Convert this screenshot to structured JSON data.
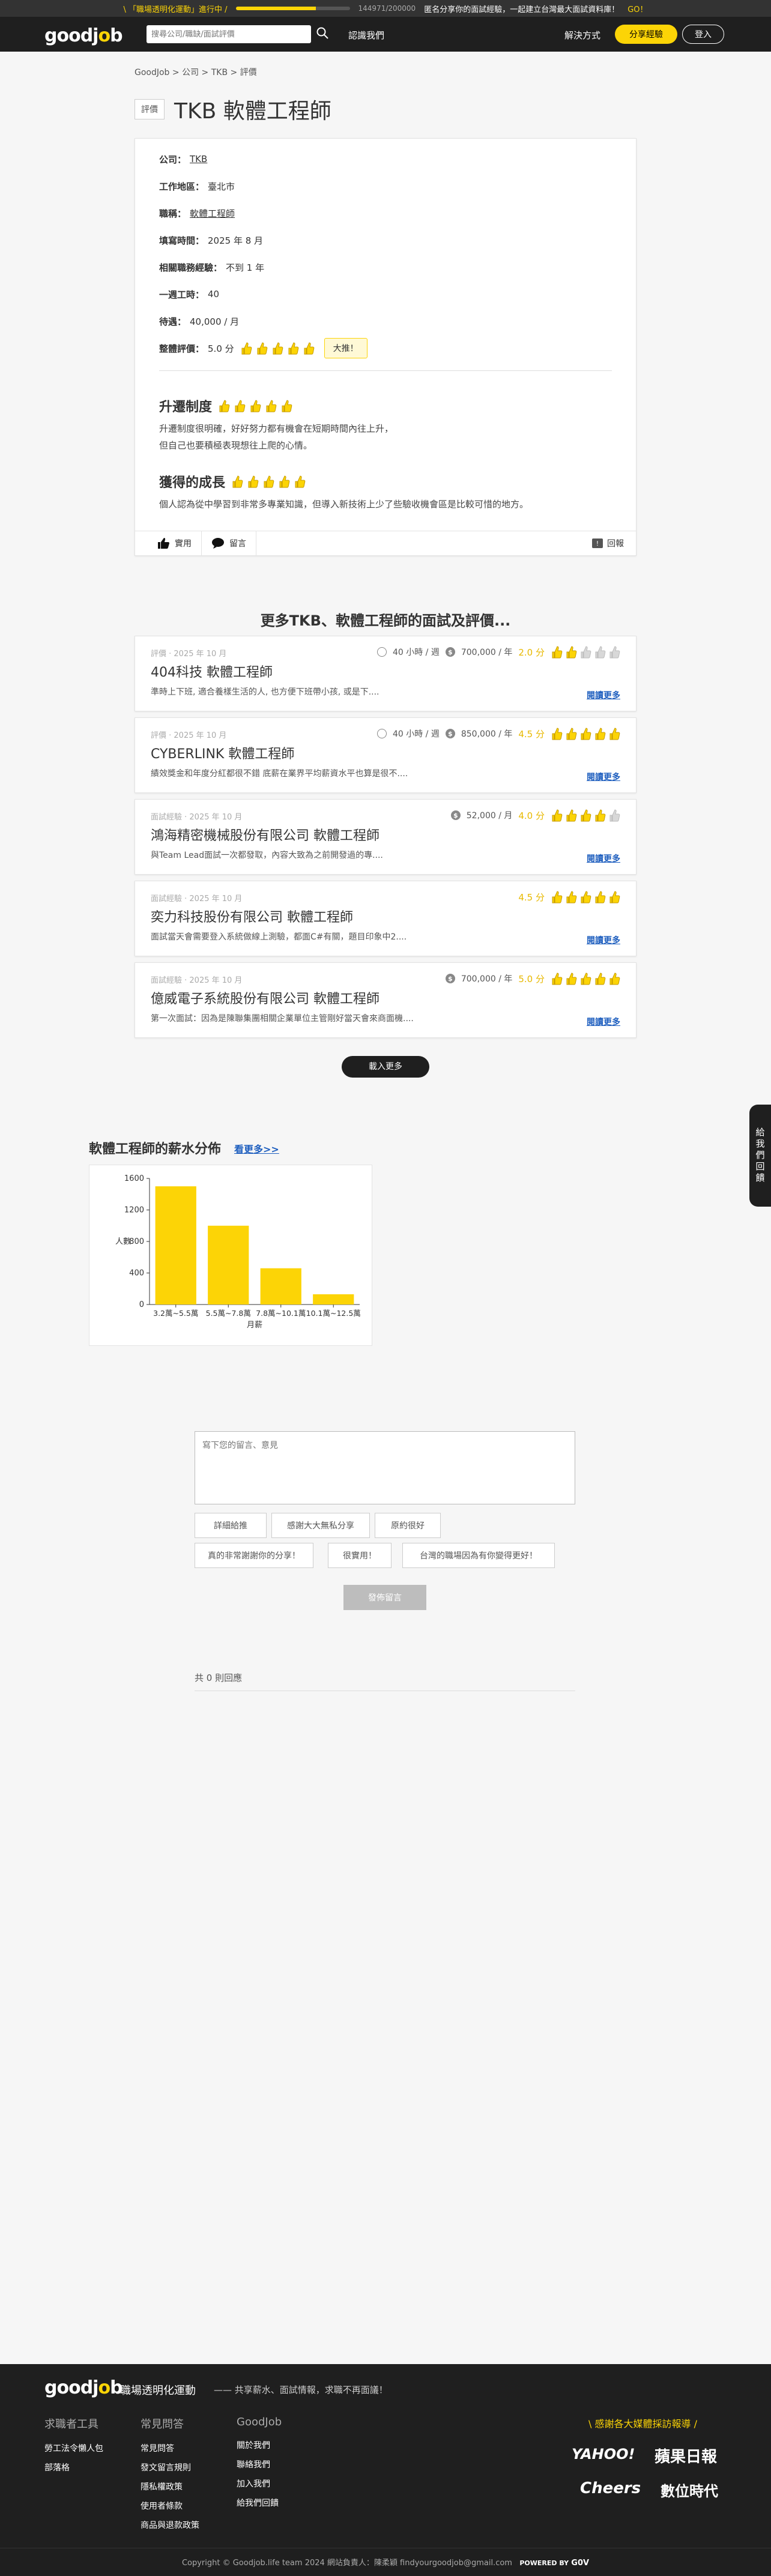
{
  "banner": {
    "campaign": "\\ 「職場透明化運動」進行中 /",
    "progress_fraction": 0.7,
    "count": "144971/200000",
    "invite": "匿名分享你的面試經驗，一起建立台灣最大面試資料庫！",
    "go": "GO！"
  },
  "header": {
    "logo_main": "goodj",
    "logo_accent": "o",
    "logo_end": "b",
    "search_placeholder": "搜尋公司/職缺/面試評價",
    "about": "認識我們",
    "solution": "解決方式",
    "share": "分享經驗",
    "login": "登入"
  },
  "breadcrumb": "GoodJob > 公司 > TKB > 評價",
  "review": {
    "tag": "評價",
    "title": "TKB 軟體工程師",
    "fields": [
      {
        "label": "公司：",
        "value": "TKB",
        "link": true
      },
      {
        "label": "工作地區：",
        "value": "臺北市",
        "link": false
      },
      {
        "label": "職稱：",
        "value": "軟體工程師",
        "link": true
      },
      {
        "label": "填寫時間：",
        "value": "2025 年 8 月",
        "link": false
      },
      {
        "label": "相關職務經驗：",
        "value": "不到 1 年",
        "link": false
      },
      {
        "label": "一週工時：",
        "value": "40",
        "link": false
      },
      {
        "label": "待遇：",
        "value": "40,000 / 月",
        "link": false
      }
    ],
    "overall_label": "整體評價：",
    "overall_value": "5.0 分",
    "overall_badge": "大推！",
    "sections": [
      {
        "title": "升遷制度",
        "body_line1": "升遷制度很明確，好好努力都有機會在短期時間內往上升，",
        "body_line2": "但自己也要積極表現想往上爬的心情。"
      },
      {
        "title": "獲得的成長",
        "body_line1": "個人認為從中學習到非常多專業知識，但導入新技術上少了些驗收機會區是比較可惜的地方。",
        "body_line2": ""
      }
    ],
    "useful": "實用",
    "comment": "留言",
    "reply": "回報"
  },
  "more": {
    "title": "更多TKB、軟體工程師的面試及評價...",
    "read_more": "閱讀更多",
    "load_more": "載入更多",
    "items": [
      {
        "meta": "評價 · 2025 年 10 月",
        "title": "404科技 軟體工程師",
        "snippet": "準時上下班, 適合養樣生活的人, 也方便下班帶小孩, 或是下....",
        "hours": "40 小時 / 週",
        "salary": "700,000 / 年",
        "rating": "2.0 分",
        "stars": 2
      },
      {
        "meta": "評價 · 2025 年 10 月",
        "title": "CYBERLINK 軟體工程師",
        "snippet": "績效獎金和年度分紅都很不錯 底薪在業界平均薪資水平也算是很不....",
        "hours": "40 小時 / 週",
        "salary": "850,000 / 年",
        "rating": "4.5 分",
        "stars": 5
      },
      {
        "meta": "面試經驗 · 2025 年 10 月",
        "title": "鴻海精密機械股份有限公司 軟體工程師",
        "snippet": "與Team Lead面試一次都發取，內容大致為之前開發過的專....",
        "hours": "",
        "salary": "52,000 / 月",
        "rating": "4.0 分",
        "stars": 4
      },
      {
        "meta": "面試經驗 · 2025 年 10 月",
        "title": "奕力科技股份有限公司 軟體工程師",
        "snippet": "面試當天會需要登入系統做線上測驗，都面C#有關，題目印象中2....",
        "hours": "",
        "salary": "",
        "rating": "4.5 分",
        "stars": 5
      },
      {
        "meta": "面試經驗 · 2025 年 10 月",
        "title": "億威電子系統股份有限公司 軟體工程師",
        "snippet": "第一次面試：因為是陳聯集團相關企業單位主管剛好當天會來商面機....",
        "hours": "",
        "salary": "700,000 / 年",
        "rating": "5.0 分",
        "stars": 5
      }
    ]
  },
  "salary": {
    "title": "軟體工程師的薪水分佈",
    "more": "看更多>>"
  },
  "chart_data": {
    "type": "bar",
    "categories": [
      "3.2萬~5.5萬",
      "5.5萬~7.8萬",
      "7.8萬~10.1萬",
      "10.1萬~12.5萬"
    ],
    "values": [
      1500,
      1000,
      460,
      130
    ],
    "xlabel": "月薪",
    "ylabel": "人數",
    "ylim": [
      0,
      1600
    ],
    "yticks": [
      0,
      400,
      800,
      1200,
      1600
    ],
    "color": "#fcd406",
    "grid": false
  },
  "comment_form": {
    "placeholder": "寫下您的留言、意見",
    "chips": [
      "詳細給推",
      "感謝大大無私分享",
      "原約很好",
      "真的非常謝謝你的分享！",
      "很實用！",
      "台灣的職場因為有你變得更好！"
    ],
    "submit": "發佈留言",
    "count": "共 0 則回應"
  },
  "sidetab": "給我們回饋",
  "footer": {
    "movement": "職場透明化運動",
    "slogan": "—— 共享薪水、面試情報，求職不再面議！",
    "columns": [
      {
        "title": "求職者工具",
        "items": [
          "勞工法令懶人包",
          "部落格"
        ]
      },
      {
        "title": "常見問答",
        "items": [
          "常見問答",
          "發文留言規則",
          "隱私權政策",
          "使用者條款",
          "商品與退款政策"
        ]
      },
      {
        "title": "GoodJob",
        "items": [
          "關於我們",
          "聯絡我們",
          "加入我們",
          "給我們回饋"
        ]
      }
    ],
    "media_title": "\\ 感謝各大媒體採訪報導 /",
    "media": [
      "YAHOO!",
      "蘋果日報",
      "Cheers",
      "數位時代"
    ],
    "copyright": "Copyright © Goodjob.life team 2024   網站負責人：陳柔穎 findyourgoodjob@gmail.com",
    "powered": "POWERED BY",
    "gov": "G0V"
  }
}
